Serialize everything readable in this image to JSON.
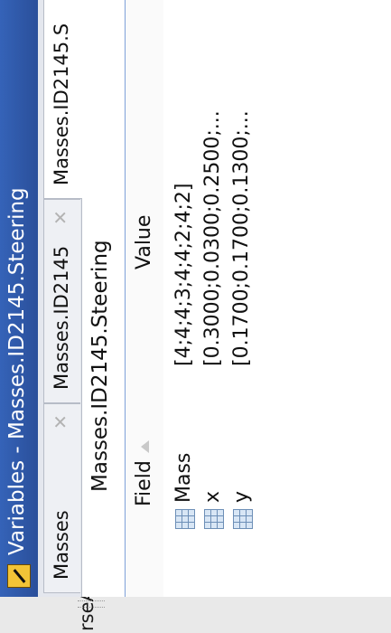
{
  "edge": {
    "label": "rseAv"
  },
  "window": {
    "title": "Variables - Masses.ID2145.Steering"
  },
  "tabs": [
    {
      "label": "Masses",
      "closable": true,
      "active": false
    },
    {
      "label": "Masses.ID2145",
      "closable": true,
      "active": false
    },
    {
      "label": "Masses.ID2145.S",
      "closable": false,
      "active": true
    }
  ],
  "path": {
    "label": "Masses.ID2145.Steering"
  },
  "table": {
    "columns": [
      "Field",
      "Value"
    ],
    "rows": [
      {
        "field": "Mass",
        "value": "[4;4;4;3;4;4;2;4;2]"
      },
      {
        "field": "x",
        "value": "[0.3000;0.0300;0.2500;..."
      },
      {
        "field": "y",
        "value": "[0.1700;0.1700;0.1300;..."
      }
    ]
  },
  "icons": {
    "app": "matlab-variables-icon",
    "close": "close-x-icon",
    "field": "struct-field-icon",
    "sort": "sort-ascending-icon"
  },
  "colors": {
    "titlebar": "#2f57a8",
    "accent": "#7ea0d8"
  }
}
